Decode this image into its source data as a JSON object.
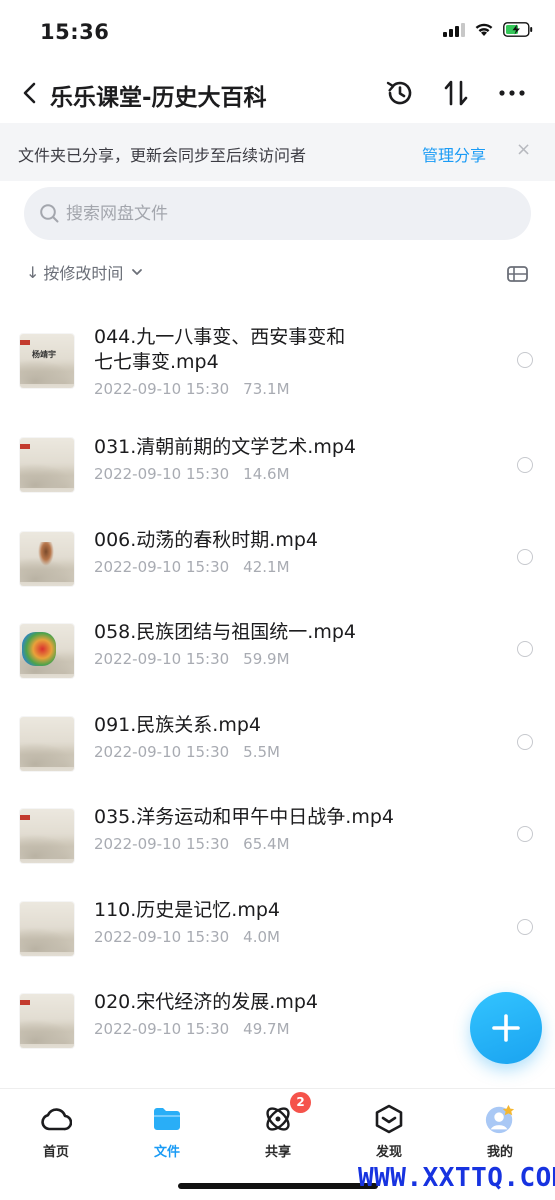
{
  "status_bar": {
    "time": "15:36"
  },
  "header": {
    "title": "乐乐课堂-历史大百科"
  },
  "banner": {
    "text": "文件夹已分享，更新会同步至后续访问者",
    "link": "管理分享",
    "close": "×"
  },
  "search": {
    "placeholder": "搜索网盘文件"
  },
  "sort": {
    "arrow": "↓",
    "label": "按修改时间"
  },
  "files": [
    {
      "name_line1": "044.九一八事变、西安事变和",
      "name_line2": "七七事变.mp4",
      "date": "2022-09-10 15:30",
      "size": "73.1M"
    },
    {
      "name_line1": "031.清朝前期的文学艺术.mp4",
      "name_line2": "",
      "date": "2022-09-10 15:30",
      "size": "14.6M"
    },
    {
      "name_line1": "006.动荡的春秋时期.mp4",
      "name_line2": "",
      "date": "2022-09-10 15:30",
      "size": "42.1M"
    },
    {
      "name_line1": "058.民族团结与祖国统一.mp4",
      "name_line2": "",
      "date": "2022-09-10 15:30",
      "size": "59.9M"
    },
    {
      "name_line1": "091.民族关系.mp4",
      "name_line2": "",
      "date": "2022-09-10 15:30",
      "size": "5.5M"
    },
    {
      "name_line1": "035.洋务运动和甲午中日战争.mp4",
      "name_line2": "",
      "date": "2022-09-10 15:30",
      "size": "65.4M"
    },
    {
      "name_line1": "110.历史是记忆.mp4",
      "name_line2": "",
      "date": "2022-09-10 15:30",
      "size": "4.0M"
    },
    {
      "name_line1": "020.宋代经济的发展.mp4",
      "name_line2": "",
      "date": "2022-09-10 15:30",
      "size": "49.7M"
    }
  ],
  "thumb_text": {
    "file0": "杨靖宇"
  },
  "tabs": [
    {
      "label": "首页",
      "icon": "cloud-icon"
    },
    {
      "label": "文件",
      "icon": "folder-icon",
      "active": true
    },
    {
      "label": "共享",
      "icon": "orbit-icon",
      "badge": "2"
    },
    {
      "label": "发现",
      "icon": "cube-icon"
    },
    {
      "label": "我的",
      "icon": "avatar-icon"
    }
  ],
  "watermark": "WWW.XXTTQ.COM",
  "colors": {
    "accent": "#1a9bf5",
    "badge": "#f5534b",
    "battery": "#34c759"
  }
}
